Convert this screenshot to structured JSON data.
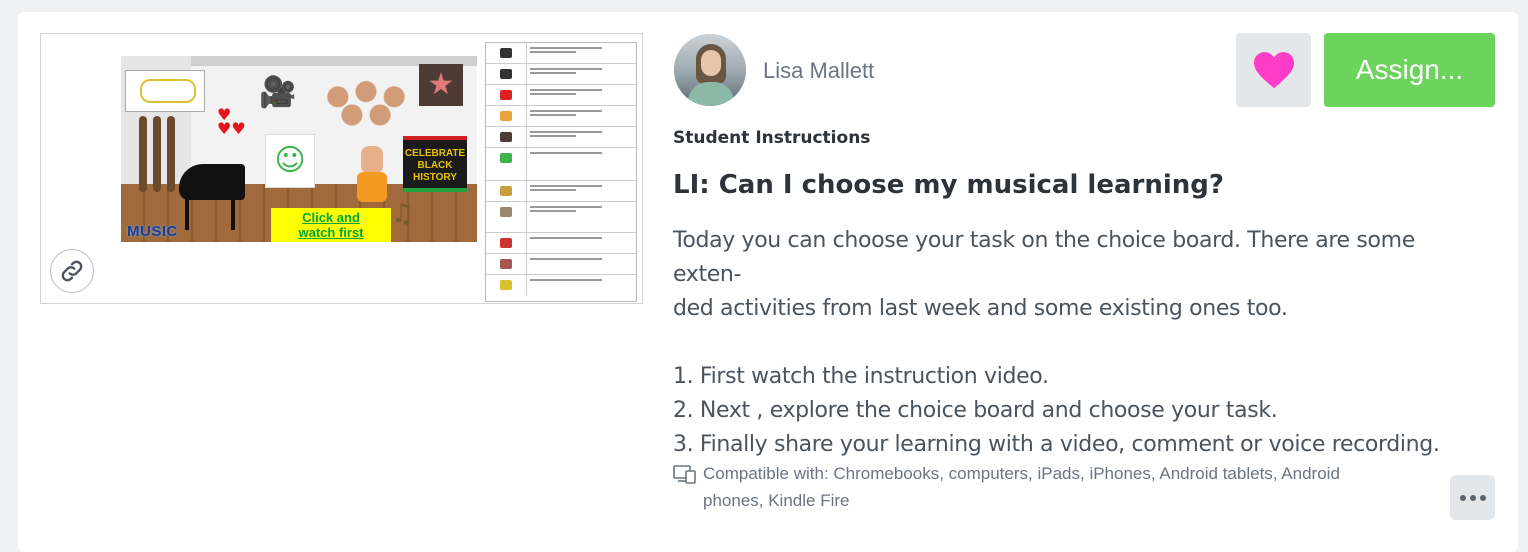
{
  "author": {
    "name": "Lisa Mallett"
  },
  "actions": {
    "like_icon": "heart-icon",
    "assign_label": "Assign...",
    "more_icon": "ellipsis-icon"
  },
  "colors": {
    "heart": "#ff3cc7",
    "assign_bg": "#6cd35c",
    "button_bg": "#e4e7ea"
  },
  "thumbnail": {
    "room_labels": {
      "music": "MUSIC",
      "click_line1": "Click and",
      "click_line2": "watch first",
      "bhm_line1": "CELEBRATE",
      "bhm_line2": "BLACK",
      "bhm_line3": "HISTORY"
    },
    "link_icon": "link-icon"
  },
  "instructions": {
    "label": "Student Instructions",
    "title": "LI: Can I choose my musical learning?",
    "paragraph_line1": "Today you can choose your task on the choice board. There are some exten-",
    "paragraph_line2": "ded activities from last week and some existing ones too.",
    "steps": [
      "1. First watch the instruction video.",
      "2. Next , explore the choice board and choose your task.",
      "3. Finally share your learning with a video, comment or voice recording."
    ]
  },
  "compatibility": {
    "line1": "Compatible with: Chromebooks, computers, iPads, iPhones, Android tablets, Android",
    "line2": "phones, Kindle Fire"
  }
}
